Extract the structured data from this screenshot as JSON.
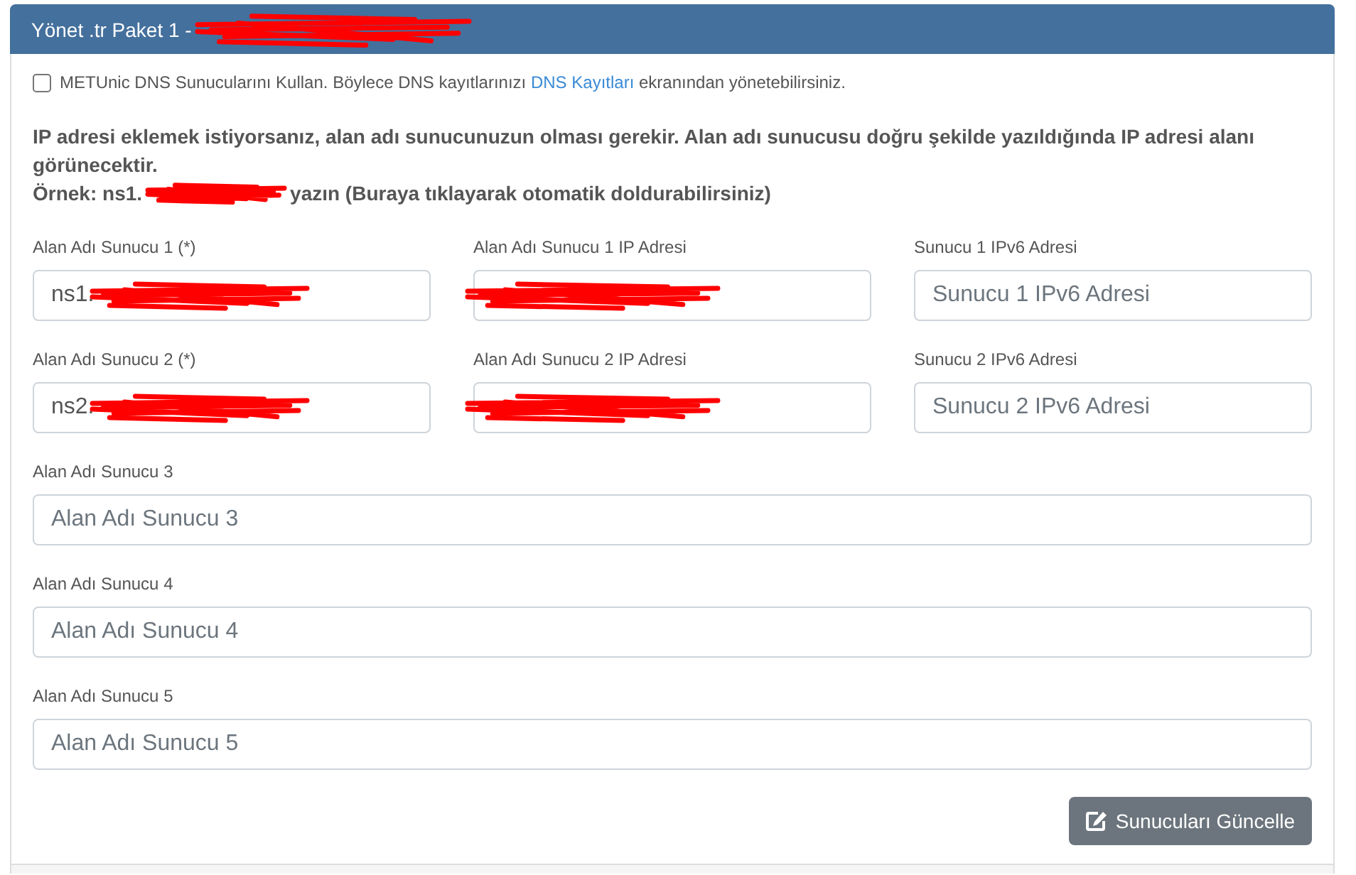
{
  "header": {
    "title": "Yönet .tr Paket 1 -",
    "redacted": true
  },
  "dns_option": {
    "checked": false,
    "before": "METUnic DNS Sunucularını Kullan. Böylece DNS kayıtlarınızı",
    "link": "DNS Kayıtları",
    "after": "ekranından yönetebilirsiniz."
  },
  "info": {
    "text": "IP adresi eklemek istiyorsanız, alan adı sunucunuzun olması gerekir. Alan adı sunucusu doğru şekilde yazıldığında IP adresi alanı görünecektir.",
    "example_before": "Örnek: ns1.",
    "example_redacted": true,
    "example_after": "yazın (Buraya tıklayarak otomatik doldurabilirsiniz)"
  },
  "form": {
    "rows": [
      {
        "fields": [
          {
            "label": "Alan Adı Sunucu 1 (*)",
            "value": "ns1.",
            "redacted": true
          },
          {
            "label": "Alan Adı Sunucu 1 IP Adresi",
            "redacted": true
          },
          {
            "label": "Sunucu 1 IPv6 Adresi",
            "placeholder": "Sunucu 1 IPv6 Adresi",
            "redacted": false
          }
        ]
      },
      {
        "fields": [
          {
            "label": "Alan Adı Sunucu 2 (*)",
            "value": "ns2.",
            "redacted": true
          },
          {
            "label": "Alan Adı Sunucu 2 IP Adresi",
            "redacted": true
          },
          {
            "label": "Sunucu 2 IPv6 Adresi",
            "placeholder": "Sunucu 2 IPv6 Adresi",
            "redacted": false
          }
        ]
      },
      {
        "fields": [
          {
            "label": "Alan Adı Sunucu 3",
            "placeholder": "Alan Adı Sunucu 3",
            "redacted": false
          }
        ]
      },
      {
        "fields": [
          {
            "label": "Alan Adı Sunucu 4",
            "placeholder": "Alan Adı Sunucu 4",
            "redacted": false
          }
        ]
      },
      {
        "fields": [
          {
            "label": "Alan Adı Sunucu 5",
            "placeholder": "Alan Adı Sunucu 5",
            "redacted": false
          }
        ]
      }
    ],
    "submit": {
      "label": "Sunucuları Güncelle"
    }
  }
}
